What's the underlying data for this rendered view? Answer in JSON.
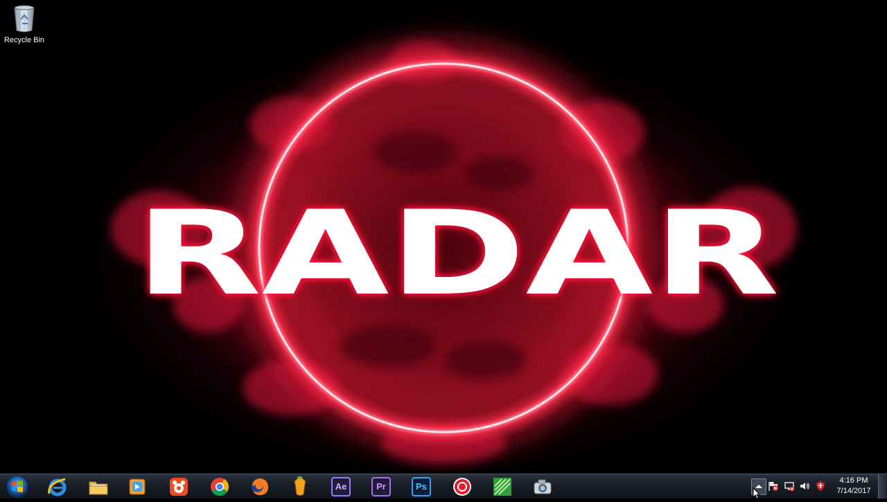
{
  "desktop": {
    "icons": [
      {
        "label": "Recycle Bin",
        "icon": "recycle-bin-icon"
      }
    ],
    "wallpaper": {
      "text": "RADAR",
      "colors": {
        "glow": "#ff1a3c",
        "ring": "#ffd6dc",
        "text": "#ffffff",
        "background": "#000000"
      }
    }
  },
  "taskbar": {
    "start": {
      "icon": "windows-start-orb-icon"
    },
    "pinned": [
      {
        "name": "internet-explorer",
        "icon": "internet-explorer-icon",
        "text": ""
      },
      {
        "name": "windows-explorer",
        "icon": "folder-icon",
        "text": ""
      },
      {
        "name": "media-player",
        "icon": "media-player-icon",
        "text": ""
      },
      {
        "name": "gom-player",
        "icon": "gom-player-icon",
        "text": ""
      },
      {
        "name": "google-chrome",
        "icon": "chrome-icon",
        "text": ""
      },
      {
        "name": "firefox",
        "icon": "firefox-icon",
        "text": ""
      },
      {
        "name": "fl-studio",
        "icon": "fl-studio-icon",
        "text": ""
      },
      {
        "name": "after-effects",
        "icon": "after-effects-icon",
        "text": "Ae"
      },
      {
        "name": "premiere-pro",
        "icon": "premiere-pro-icon",
        "text": "Pr"
      },
      {
        "name": "photoshop",
        "icon": "photoshop-icon",
        "text": "Ps"
      },
      {
        "name": "screen-recorder",
        "icon": "record-icon",
        "text": ""
      },
      {
        "name": "camtasia",
        "icon": "camtasia-icon",
        "text": ""
      },
      {
        "name": "capture-tool",
        "icon": "camera-icon",
        "text": ""
      }
    ],
    "tray": {
      "icons": [
        "show-hidden-icons-icon",
        "action-center-flag-icon",
        "network-icon",
        "volume-icon",
        "antivirus-icon"
      ],
      "time": "4:16 PM",
      "date": "7/14/2017"
    }
  }
}
